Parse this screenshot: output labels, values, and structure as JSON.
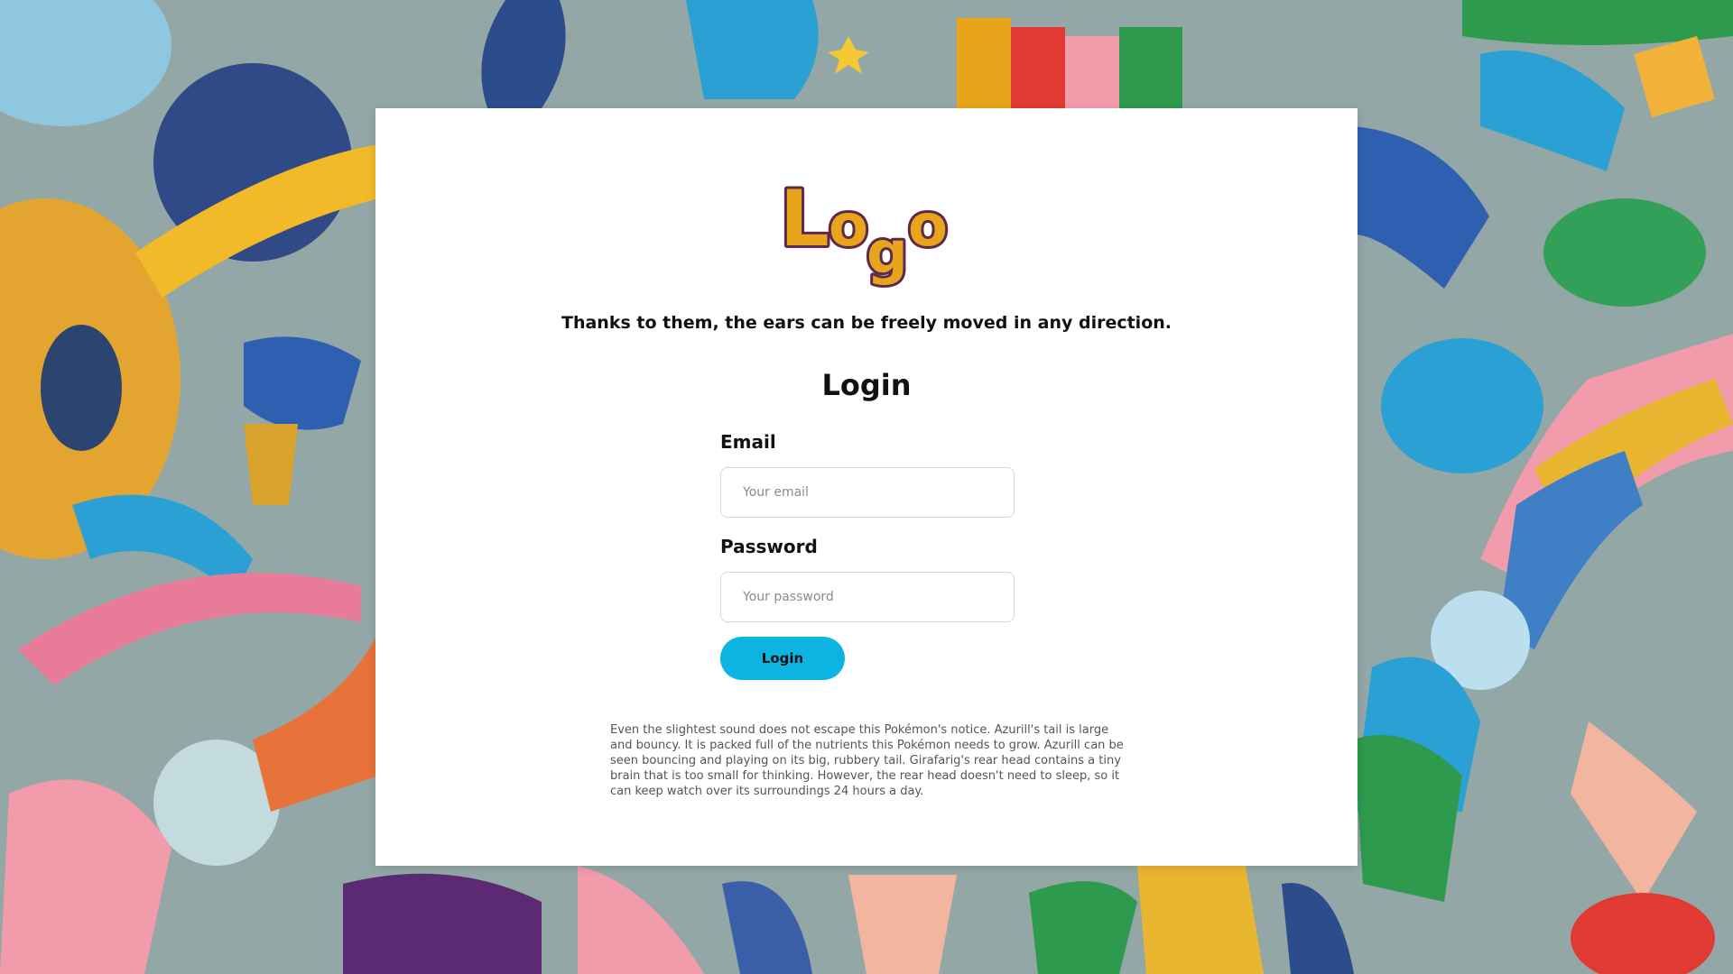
{
  "logo": {
    "text": "Logo",
    "fill": "#e8a41a",
    "outline": "#5b2a4f"
  },
  "tagline": "Thanks to them, the ears can be freely moved in any direction.",
  "login": {
    "title": "Login",
    "email_label": "Email",
    "email_placeholder": "Your email",
    "password_label": "Password",
    "password_placeholder": "Your password",
    "submit_label": "Login"
  },
  "description": "Even the slightest sound does not escape this Pokémon's notice. Azurill's tail is large and bouncy. It is packed full of the nutrients this Pokémon needs to grow. Azurill can be seen bouncing and playing on its big, rubbery tail. Girafarig's rear head contains a tiny brain that is too small for thinking. However, the rear head doesn't need to sleep, so it can keep watch over its surroundings 24 hours a day.",
  "colors": {
    "accent": "#0db4e1",
    "background": "#93a7a6",
    "card": "#ffffff"
  }
}
